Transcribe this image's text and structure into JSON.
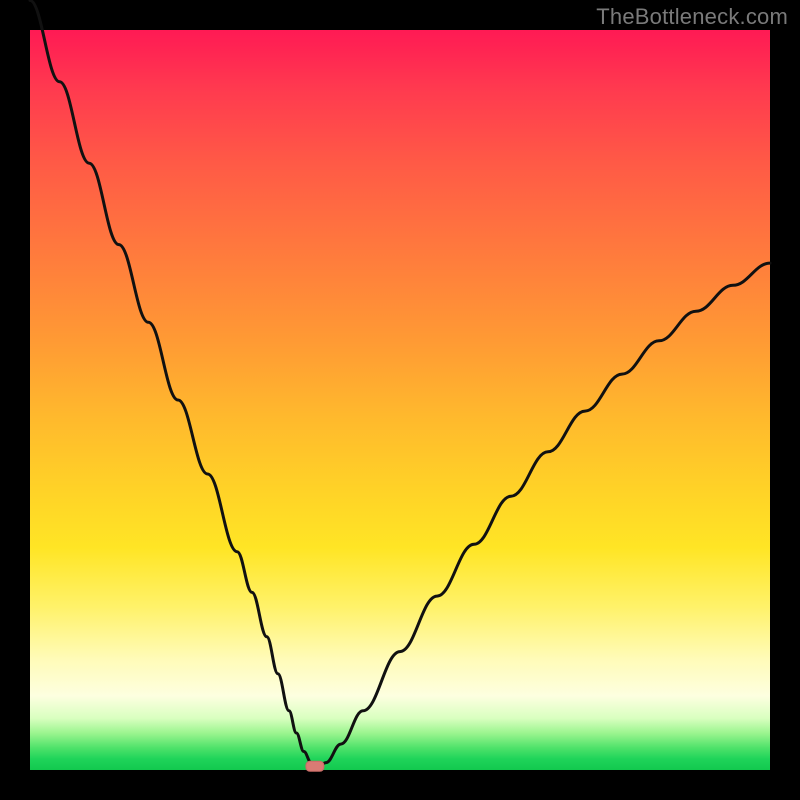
{
  "watermark": "TheBottleneck.com",
  "chart_data": {
    "type": "line",
    "title": "",
    "xlabel": "",
    "ylabel": "",
    "xlim": [
      0,
      100
    ],
    "ylim": [
      0,
      100
    ],
    "series": [
      {
        "name": "bottleneck-curve",
        "x": [
          0,
          4,
          8,
          12,
          16,
          20,
          24,
          28,
          30,
          32,
          33.5,
          35,
          36,
          37,
          38,
          39,
          40,
          42,
          45,
          50,
          55,
          60,
          65,
          70,
          75,
          80,
          85,
          90,
          95,
          100
        ],
        "y": [
          104,
          93,
          82,
          71,
          60.5,
          50,
          40,
          29.5,
          24,
          18,
          13,
          8,
          5,
          2.5,
          1,
          0.5,
          1,
          3.5,
          8,
          16,
          23.5,
          30.5,
          37,
          43,
          48.5,
          53.5,
          58,
          62,
          65.5,
          68.5
        ]
      }
    ],
    "marker": {
      "x": 38.5,
      "y": 0.5,
      "color": "#d97b74"
    },
    "background_gradient": {
      "top": "#ff1a54",
      "mid": "#ffe525",
      "bottom": "#12c94e"
    }
  }
}
